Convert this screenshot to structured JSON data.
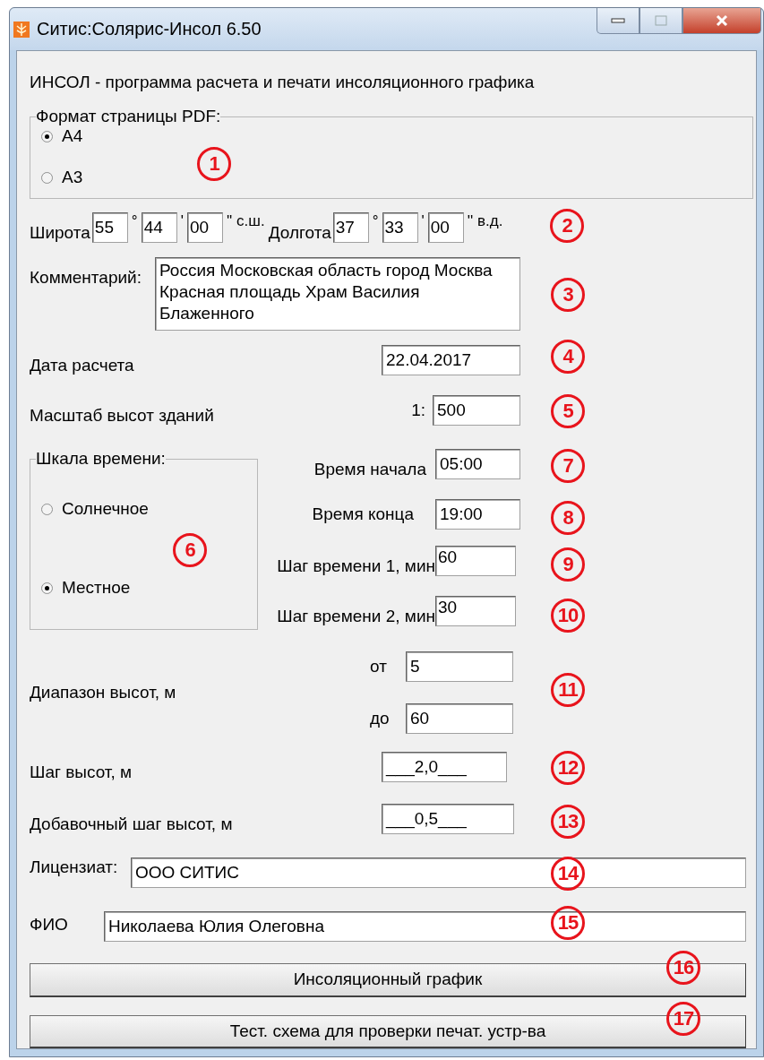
{
  "window": {
    "title": "Ситис:Солярис-Инсол 6.50"
  },
  "description": "ИНСОЛ - программа расчета и печати инсоляционного графика",
  "pdf_format": {
    "label": "Формат страницы PDF:",
    "options": [
      {
        "label": "А4",
        "selected": true
      },
      {
        "label": "А3",
        "selected": false
      }
    ]
  },
  "coordinates": [
    {
      "label": "Широта",
      "degrees": "55",
      "deg_sign": "°",
      "minutes": "44",
      "min_sign": "'",
      "seconds": "00",
      "suffix": "'' с.ш."
    },
    {
      "label": "Долгота",
      "degrees": "37",
      "deg_sign": "°",
      "minutes": "33",
      "min_sign": "'",
      "seconds": "00",
      "suffix": "'' в.д."
    }
  ],
  "comment": {
    "label": "Комментарий:",
    "value": "Россия Московская область город Москва Красная площадь Храм Василия Блаженного"
  },
  "calc_date": {
    "label": "Дата расчета",
    "value": "22.04.2017"
  },
  "height_scale": {
    "label": "Масштаб высот зданий",
    "prefix": "1:",
    "value": "500"
  },
  "time_scale": {
    "label": "Шкала времени:",
    "options": [
      {
        "label": "Солнечное",
        "selected": false
      },
      {
        "label": "Местное",
        "selected": true
      }
    ]
  },
  "time_fields": [
    {
      "label": "Время начала",
      "value": "05:00"
    },
    {
      "label": "Время конца",
      "value": "19:00"
    },
    {
      "label": "Шаг времени 1, мин",
      "value": "60"
    },
    {
      "label": "Шаг времени 2, мин",
      "value": "30"
    }
  ],
  "height_range": {
    "label": "Диапазон высот, м",
    "from_label": "от",
    "from": "5",
    "to_label": "до",
    "to": "60"
  },
  "height_step": {
    "label": "Шаг высот, м",
    "value": "___2,0___"
  },
  "extra_height_step": {
    "label": "Добавочный шаг высот, м",
    "value": "___0,5___"
  },
  "licensee": {
    "label": "Лицензиат:",
    "value": "ООО СИТИС"
  },
  "full_name": {
    "label": "ФИО",
    "value": "Николаева Юлия Олеговна"
  },
  "buttons": [
    "Инсоляционный график",
    "Тест. схема  для проверки печат. устр-ва"
  ],
  "annotations": [
    "1",
    "2",
    "3",
    "4",
    "5",
    "6",
    "7",
    "8",
    "9",
    "10",
    "11",
    "12",
    "13",
    "14",
    "15",
    "16",
    "17"
  ]
}
